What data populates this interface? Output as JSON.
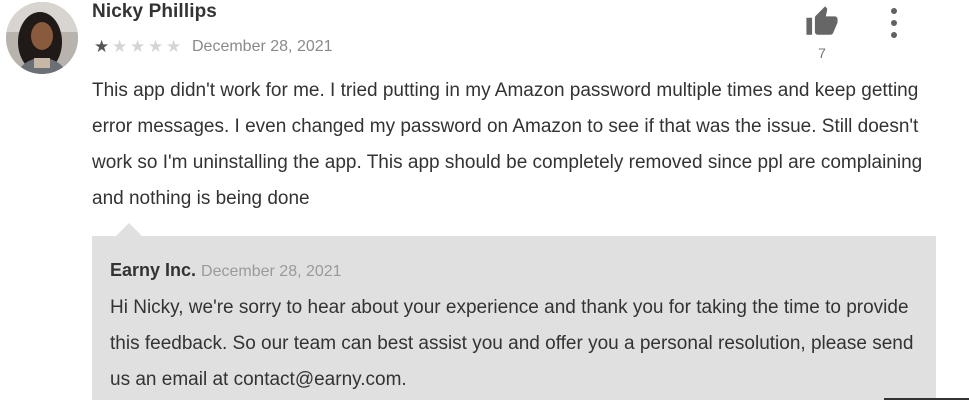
{
  "review": {
    "author": "Nicky Phillips",
    "rating": 1,
    "max_rating": 5,
    "date": "December 28, 2021",
    "text": "This app didn't work for me. I tried putting in my Amazon password multiple times and keep getting error messages. I even changed my password on Amazon to see if that was the issue. Still doesn't work so I'm uninstalling the app. This app should be completely removed since ppl are complaining and nothing is being done",
    "helpful_count": "7",
    "icons": {
      "avatar": "user-avatar",
      "helpful": "thumbs-up-icon",
      "menu": "more-vert-icon",
      "star": "star-icon"
    }
  },
  "reply": {
    "author": "Earny Inc.",
    "date": "December 28, 2021",
    "text": "Hi Nicky, we're sorry to hear about your experience and thank you for taking the time to provide this feedback. So our team can best assist you and offer you a personal resolution, please send us an email at contact@earny.com."
  },
  "colors": {
    "text": "#333333",
    "muted": "#8a8a8a",
    "reply_background": "#e0e0e0",
    "star_filled": "#555555",
    "star_empty": "#d5d5d5"
  }
}
